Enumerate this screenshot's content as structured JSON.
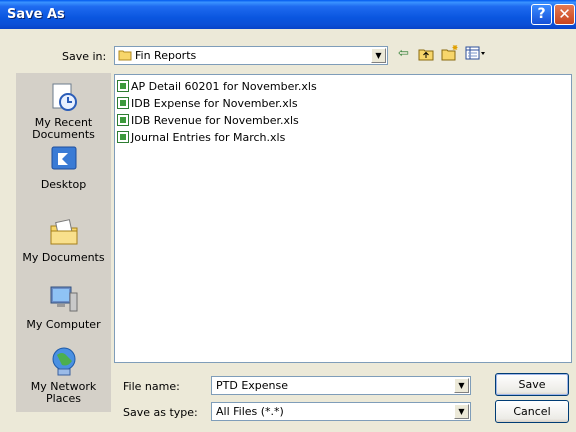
{
  "title": "Save As",
  "titlebar": {
    "help": "?",
    "close": "✕"
  },
  "save_in": {
    "label": "Save in:",
    "value": "Fin Reports",
    "folder_icon": "folder-icon"
  },
  "toolbar": {
    "back_icon": "back-arrow-icon",
    "up_icon": "up-folder-icon",
    "new_folder_icon": "new-folder-icon",
    "views_icon": "views-menu-icon"
  },
  "places": [
    {
      "label": "My Recent Documents",
      "icon": "recent-documents-icon"
    },
    {
      "label": "Desktop",
      "icon": "desktop-icon"
    },
    {
      "label": "My Documents",
      "icon": "my-documents-icon"
    },
    {
      "label": "My Computer",
      "icon": "my-computer-icon"
    },
    {
      "label": "My Network Places",
      "icon": "network-places-icon"
    }
  ],
  "files": [
    "AP Detail 60201 for November.xls",
    "IDB Expense for November.xls",
    "IDB Revenue for November.xls",
    "Journal Entries for March.xls"
  ],
  "file_name": {
    "label": "File name:",
    "value": "PTD Expense"
  },
  "save_type": {
    "label": "Save as type:",
    "value": "All Files (*.*)"
  },
  "buttons": {
    "save": "Save",
    "cancel": "Cancel"
  }
}
